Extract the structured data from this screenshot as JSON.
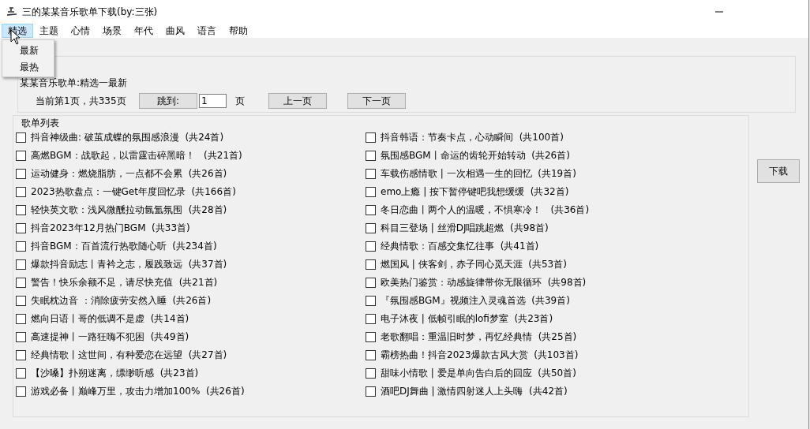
{
  "window": {
    "title": "三的某某音乐歌单下载(by:三张)"
  },
  "menu": [
    {
      "label": "精选",
      "selected": true
    },
    {
      "label": "主题",
      "selected": false
    },
    {
      "label": "心情",
      "selected": false
    },
    {
      "label": "场景",
      "selected": false
    },
    {
      "label": "年代",
      "selected": false
    },
    {
      "label": "曲风",
      "selected": false
    },
    {
      "label": "语言",
      "selected": false
    },
    {
      "label": "帮助",
      "selected": false
    }
  ],
  "dropdown": [
    {
      "label": "最新"
    },
    {
      "label": "最热"
    }
  ],
  "current_list": "某某音乐歌单:精选一最新",
  "pager": {
    "info": "当前第1页，共335页",
    "jump_button": "跳到:",
    "page_value": "1",
    "page_unit": "页",
    "prev_button": "上一页",
    "next_button": "下一页"
  },
  "playlist_group": {
    "title": "歌单列表",
    "items": [
      {
        "label": "抖音神级曲: 破茧成蝶的氛围感浪漫  (共24首)",
        "checked": false
      },
      {
        "label": "高燃BGM：战歌起，以雷霆击碎黑暗！   (共21首)",
        "checked": false
      },
      {
        "label": "运动健身：燃烧脂肪，一点都不会累  (共26首)",
        "checked": false
      },
      {
        "label": "2023热歌盘点：一键Get年度回忆录  (共166首)",
        "checked": false
      },
      {
        "label": "轻快英文歌：浅风微醺拉动氤氲氛围  (共28首)",
        "checked": false
      },
      {
        "label": "抖音2023年12月热门BGM  (共33首)",
        "checked": false
      },
      {
        "label": "抖音BGM：百首流行热歌随心听  (共234首)",
        "checked": false
      },
      {
        "label": "爆款抖音励志丨青衿之志，履践致远  (共37首)",
        "checked": false
      },
      {
        "label": "警告！快乐余额不足，请尽快充值  (共21首)",
        "checked": false
      },
      {
        "label": "失眠枕边音 ：消除疲劳安然入睡  (共26首)",
        "checked": false
      },
      {
        "label": "燃向日语丨哥的低调不是虚  (共14首)",
        "checked": false
      },
      {
        "label": "高速提神丨一路狂嗨不犯困  (共49首)",
        "checked": false
      },
      {
        "label": "经典情歌丨这世间，有种爱恋在远望  (共27首)",
        "checked": false
      },
      {
        "label": "【沙嗓】扑朔迷离，缥缈听感  (共23首)",
        "checked": false
      },
      {
        "label": "游戏必备丨巅峰万里，攻击力增加100%  (共26首)",
        "checked": false
      },
      {
        "label": "抖音韩语：节奏卡点，心动瞬间  (共100首)",
        "checked": false
      },
      {
        "label": "氛围感BGM丨命运的齿轮开始转动  (共26首)",
        "checked": false
      },
      {
        "label": "车载伤感情歌 | 一次相遇一生的回忆  (共19首)",
        "checked": false
      },
      {
        "label": "emo上瘾 | 按下暂停键吧我想缓缓  (共32首)",
        "checked": false
      },
      {
        "label": "冬日恋曲丨两个人的温暖，不惧寒冷！   (共36首)",
        "checked": false
      },
      {
        "label": "科目三登场 | 丝滑DJ唱跳超燃  (共98首)",
        "checked": false
      },
      {
        "label": "经典情歌：百感交集忆往事  (共41首)",
        "checked": false
      },
      {
        "label": "燃国风 | 侠客剑，赤子同心觅天涯  (共53首)",
        "checked": false
      },
      {
        "label": "欧美热门鉴赏：动感旋律带你无限循环  (共98首)",
        "checked": false
      },
      {
        "label": "『氛围感BGM』视频注入灵魂首选  (共39首)",
        "checked": false
      },
      {
        "label": "电子沐夜 | 低帧引眠的lofi梦室  (共23首)",
        "checked": false
      },
      {
        "label": "老歌翻唱：重温旧时梦，再忆经典情  (共25首)",
        "checked": false
      },
      {
        "label": "霸榜热曲！抖音2023爆款古风大赏  (共103首)",
        "checked": false
      },
      {
        "label": "甜味小情歌 | 爱是单向告白后的回应  (共50首)",
        "checked": false
      },
      {
        "label": "酒吧DJ舞曲 | 激情四射迷人上头嗨  (共42首)",
        "checked": false
      }
    ]
  },
  "download_button": "下载"
}
